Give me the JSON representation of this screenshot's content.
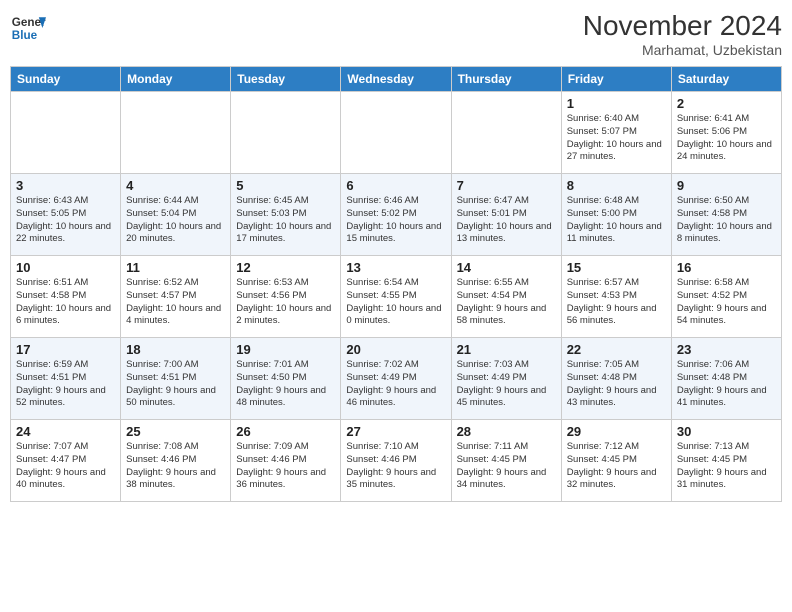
{
  "logo": {
    "line1": "General",
    "line2": "Blue"
  },
  "title": "November 2024",
  "subtitle": "Marhamat, Uzbekistan",
  "days_header": [
    "Sunday",
    "Monday",
    "Tuesday",
    "Wednesday",
    "Thursday",
    "Friday",
    "Saturday"
  ],
  "weeks": [
    [
      {
        "day": "",
        "info": ""
      },
      {
        "day": "",
        "info": ""
      },
      {
        "day": "",
        "info": ""
      },
      {
        "day": "",
        "info": ""
      },
      {
        "day": "",
        "info": ""
      },
      {
        "day": "1",
        "info": "Sunrise: 6:40 AM\nSunset: 5:07 PM\nDaylight: 10 hours and 27 minutes."
      },
      {
        "day": "2",
        "info": "Sunrise: 6:41 AM\nSunset: 5:06 PM\nDaylight: 10 hours and 24 minutes."
      }
    ],
    [
      {
        "day": "3",
        "info": "Sunrise: 6:43 AM\nSunset: 5:05 PM\nDaylight: 10 hours and 22 minutes."
      },
      {
        "day": "4",
        "info": "Sunrise: 6:44 AM\nSunset: 5:04 PM\nDaylight: 10 hours and 20 minutes."
      },
      {
        "day": "5",
        "info": "Sunrise: 6:45 AM\nSunset: 5:03 PM\nDaylight: 10 hours and 17 minutes."
      },
      {
        "day": "6",
        "info": "Sunrise: 6:46 AM\nSunset: 5:02 PM\nDaylight: 10 hours and 15 minutes."
      },
      {
        "day": "7",
        "info": "Sunrise: 6:47 AM\nSunset: 5:01 PM\nDaylight: 10 hours and 13 minutes."
      },
      {
        "day": "8",
        "info": "Sunrise: 6:48 AM\nSunset: 5:00 PM\nDaylight: 10 hours and 11 minutes."
      },
      {
        "day": "9",
        "info": "Sunrise: 6:50 AM\nSunset: 4:58 PM\nDaylight: 10 hours and 8 minutes."
      }
    ],
    [
      {
        "day": "10",
        "info": "Sunrise: 6:51 AM\nSunset: 4:58 PM\nDaylight: 10 hours and 6 minutes."
      },
      {
        "day": "11",
        "info": "Sunrise: 6:52 AM\nSunset: 4:57 PM\nDaylight: 10 hours and 4 minutes."
      },
      {
        "day": "12",
        "info": "Sunrise: 6:53 AM\nSunset: 4:56 PM\nDaylight: 10 hours and 2 minutes."
      },
      {
        "day": "13",
        "info": "Sunrise: 6:54 AM\nSunset: 4:55 PM\nDaylight: 10 hours and 0 minutes."
      },
      {
        "day": "14",
        "info": "Sunrise: 6:55 AM\nSunset: 4:54 PM\nDaylight: 9 hours and 58 minutes."
      },
      {
        "day": "15",
        "info": "Sunrise: 6:57 AM\nSunset: 4:53 PM\nDaylight: 9 hours and 56 minutes."
      },
      {
        "day": "16",
        "info": "Sunrise: 6:58 AM\nSunset: 4:52 PM\nDaylight: 9 hours and 54 minutes."
      }
    ],
    [
      {
        "day": "17",
        "info": "Sunrise: 6:59 AM\nSunset: 4:51 PM\nDaylight: 9 hours and 52 minutes."
      },
      {
        "day": "18",
        "info": "Sunrise: 7:00 AM\nSunset: 4:51 PM\nDaylight: 9 hours and 50 minutes."
      },
      {
        "day": "19",
        "info": "Sunrise: 7:01 AM\nSunset: 4:50 PM\nDaylight: 9 hours and 48 minutes."
      },
      {
        "day": "20",
        "info": "Sunrise: 7:02 AM\nSunset: 4:49 PM\nDaylight: 9 hours and 46 minutes."
      },
      {
        "day": "21",
        "info": "Sunrise: 7:03 AM\nSunset: 4:49 PM\nDaylight: 9 hours and 45 minutes."
      },
      {
        "day": "22",
        "info": "Sunrise: 7:05 AM\nSunset: 4:48 PM\nDaylight: 9 hours and 43 minutes."
      },
      {
        "day": "23",
        "info": "Sunrise: 7:06 AM\nSunset: 4:48 PM\nDaylight: 9 hours and 41 minutes."
      }
    ],
    [
      {
        "day": "24",
        "info": "Sunrise: 7:07 AM\nSunset: 4:47 PM\nDaylight: 9 hours and 40 minutes."
      },
      {
        "day": "25",
        "info": "Sunrise: 7:08 AM\nSunset: 4:46 PM\nDaylight: 9 hours and 38 minutes."
      },
      {
        "day": "26",
        "info": "Sunrise: 7:09 AM\nSunset: 4:46 PM\nDaylight: 9 hours and 36 minutes."
      },
      {
        "day": "27",
        "info": "Sunrise: 7:10 AM\nSunset: 4:46 PM\nDaylight: 9 hours and 35 minutes."
      },
      {
        "day": "28",
        "info": "Sunrise: 7:11 AM\nSunset: 4:45 PM\nDaylight: 9 hours and 34 minutes."
      },
      {
        "day": "29",
        "info": "Sunrise: 7:12 AM\nSunset: 4:45 PM\nDaylight: 9 hours and 32 minutes."
      },
      {
        "day": "30",
        "info": "Sunrise: 7:13 AM\nSunset: 4:45 PM\nDaylight: 9 hours and 31 minutes."
      }
    ]
  ]
}
